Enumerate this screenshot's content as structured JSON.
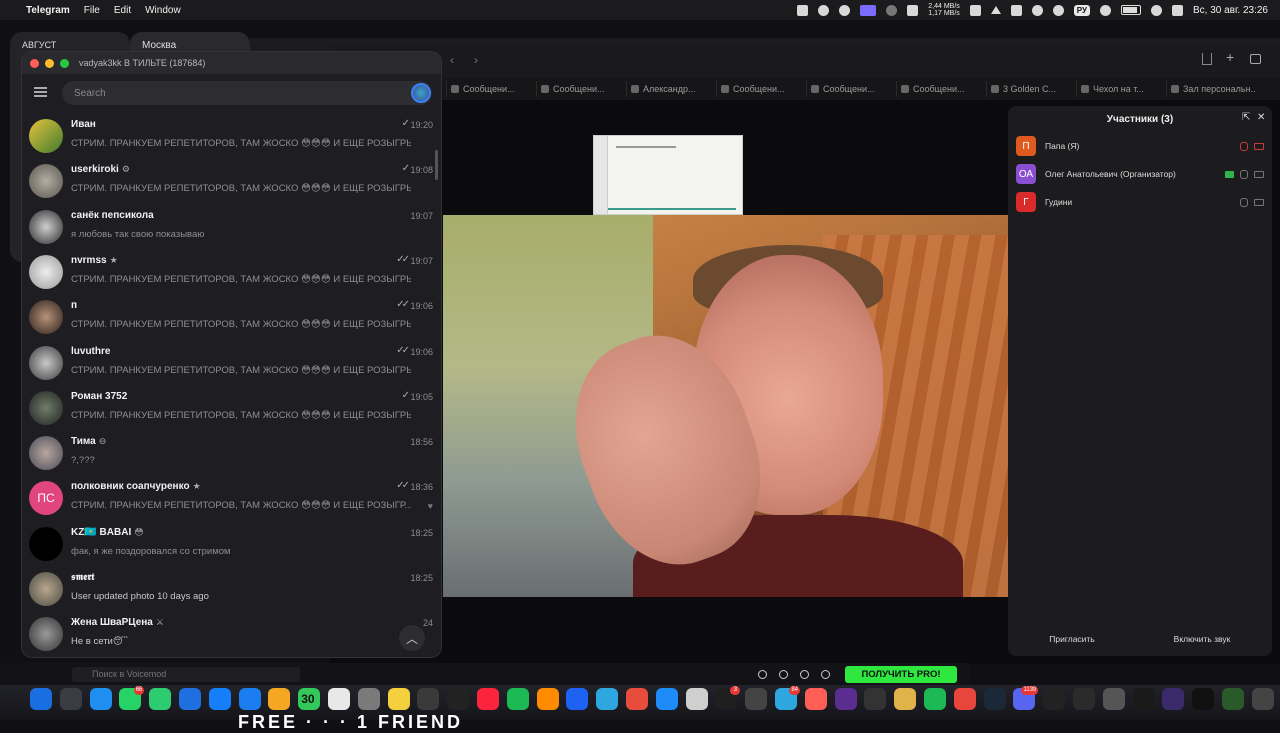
{
  "menubar": {
    "app": "Telegram",
    "menus": [
      "File",
      "Edit",
      "Window"
    ],
    "net_up": "2,44 MB/s",
    "net_down": "1,17 MB/s",
    "keyboard": "РУ",
    "datetime": "Вс, 30 авг.  23:26"
  },
  "background": {
    "calendar1_label": "АВГУСТ",
    "calendar2_label": "Москва"
  },
  "zoom": {
    "tabs": [
      "Сообщени...",
      "Сообщени...",
      "Александр...",
      "Сообщени...",
      "Сообщени...",
      "Сообщени...",
      "3 Golden C...",
      "Чехол на т...",
      "Зал персональн..."
    ],
    "participants": {
      "title": "Участники (3)",
      "list": [
        {
          "initials": "П",
          "name": "Папа (Я)",
          "color": "#e05a1f"
        },
        {
          "initials": "ОА",
          "name": "Олег Анатольевич (Организатор)",
          "color": "#8a4fd1"
        },
        {
          "initials": "Г",
          "name": "Гудини",
          "color": "#d92b2b"
        }
      ],
      "invite": "Пригласить",
      "unmute_all": "Включить звук"
    }
  },
  "telegram": {
    "window_title": "vadyak3kk В ТИЛЬТЕ (187684)",
    "search_placeholder": "Search",
    "chats": [
      {
        "name": "Иван",
        "badge": "",
        "time": "19:20",
        "check": "✓",
        "msg": "СТРИМ. ПРАНКУЕМ РЕПЕТИТОРОВ, ТАМ ЖОСКО 😳😳😳 И ЕЩЕ РОЗЫГРЫШ..."
      },
      {
        "name": "userkiroki",
        "badge": "⚙",
        "time": "19:08",
        "check": "✓",
        "msg": "СТРИМ. ПРАНКУЕМ РЕПЕТИТОРОВ, ТАМ ЖОСКО 😳😳😳 И ЕЩЕ РОЗЫГРЫШ..."
      },
      {
        "name": "санёк пепсикола",
        "badge": "",
        "time": "19:07",
        "check": "",
        "msg": "я любовь так свою показываю"
      },
      {
        "name": "nvrmss",
        "badge": "★",
        "time": "19:07",
        "check": "✓✓",
        "msg": "СТРИМ. ПРАНКУЕМ РЕПЕТИТОРОВ, ТАМ ЖОСКО 😳😳😳 И ЕЩЕ РОЗЫГРЫШ..."
      },
      {
        "name": "п",
        "badge": "",
        "time": "19:06",
        "check": "✓✓",
        "msg": "СТРИМ. ПРАНКУЕМ РЕПЕТИТОРОВ, ТАМ ЖОСКО 😳😳😳 И ЕЩЕ РОЗЫГРЫШ..."
      },
      {
        "name": "luvuthre",
        "badge": "",
        "time": "19:06",
        "check": "✓✓",
        "msg": "СТРИМ. ПРАНКУЕМ РЕПЕТИТОРОВ, ТАМ ЖОСКО 😳😳😳 И ЕЩЕ РОЗЫГРЫШ..."
      },
      {
        "name": "Роман 3752",
        "badge": "",
        "time": "19:05",
        "check": "✓",
        "msg": "СТРИМ. ПРАНКУЕМ РЕПЕТИТОРОВ, ТАМ ЖОСКО 😳😳😳 И ЕЩЕ РОЗЫГРЫШ..."
      },
      {
        "name": "Тима",
        "badge": "⊖",
        "time": "18:56",
        "check": "",
        "msg": "?,???"
      },
      {
        "name": "полковник соапчуренко",
        "badge": "★",
        "time": "18:36",
        "check": "✓✓",
        "msg": "СТРИМ. ПРАНКУЕМ РЕПЕТИТОРОВ, ТАМ ЖОСКО 😳😳😳 И ЕЩЕ РОЗЫГР...",
        "initials": "ПС"
      },
      {
        "name": "KZ🇰🇿 BABAI",
        "badge": "😳",
        "time": "18:25",
        "check": "",
        "msg": "фак, я же поздоровался со стримом"
      },
      {
        "name": "𝖘𝖒𝖊𝖗𝖙",
        "badge": "",
        "time": "18:25",
        "check": "",
        "msg": "User updated photo 10 days ago"
      },
      {
        "name": "Жена ШваРЦена",
        "badge": "⚔",
        "time": "24",
        "check": "",
        "msg": "Не в сети😴"
      }
    ]
  },
  "voicemod": {
    "search_placeholder": "Поиск в Voicemod",
    "pro_button": "ПОЛУЧИТЬ PRO!"
  },
  "dock": {
    "calendar_day": "30",
    "badges": {
      "whatsapp": "66",
      "telegram": "84",
      "discord": "1139",
      "steam": "3"
    }
  },
  "stream_banner": "FREE · · · 1 FRIEND"
}
